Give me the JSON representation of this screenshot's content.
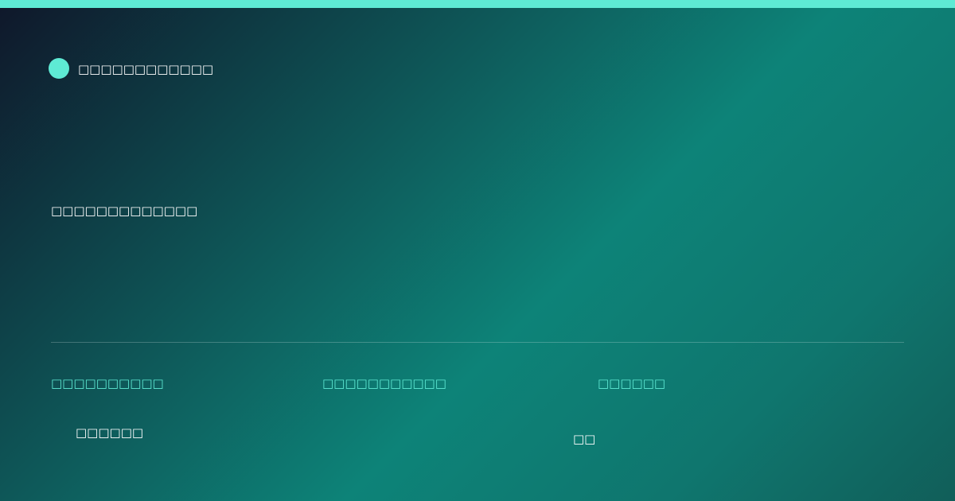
{
  "colors": {
    "accent": "#5eead4",
    "text": "#ffffff",
    "background_start": "#0f172a",
    "background_mid": "#0d8378",
    "background_end": "#115e59"
  },
  "brand": {
    "icon": "circle-logo-icon",
    "name": "□□□□□□□□□□□□"
  },
  "headline": "□□□□□□□□□□□□□",
  "stats": [
    {
      "label": "□□□□□□□□□□",
      "value": "□□□□□□"
    },
    {
      "label": "□□□□□□□□□□□",
      "value": ""
    },
    {
      "label": "□□□□□□",
      "value": "□□"
    }
  ]
}
